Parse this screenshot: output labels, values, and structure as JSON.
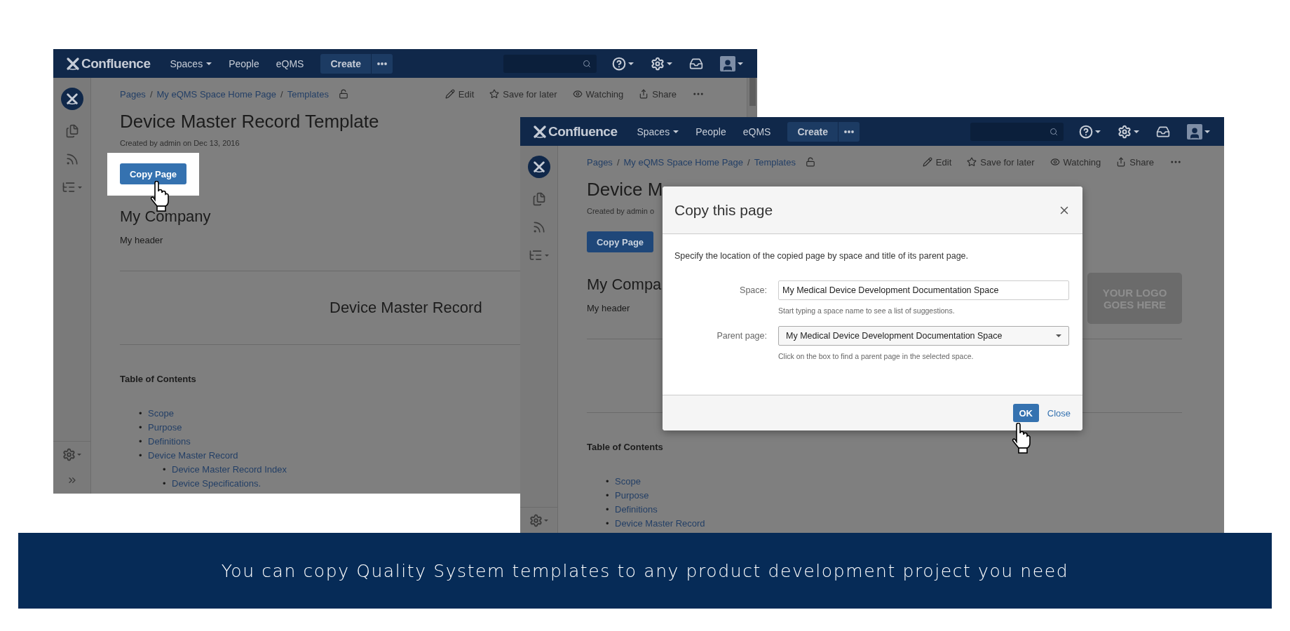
{
  "screenshots": [
    {
      "nav": {
        "logo": "Confluence",
        "menu": [
          {
            "label": "Spaces",
            "dropdown": true
          },
          {
            "label": "People",
            "dropdown": false
          },
          {
            "label": "eQMS",
            "dropdown": false
          }
        ],
        "create": "Create"
      },
      "breadcrumbs": [
        {
          "kind": "link",
          "label": "Pages"
        },
        {
          "kind": "separator",
          "label": "/"
        },
        {
          "kind": "link",
          "label": "My eQMS Space Home Page"
        },
        {
          "kind": "separator",
          "label": "/"
        },
        {
          "kind": "link",
          "label": "Templates"
        }
      ],
      "actions": [
        {
          "kind": "edit",
          "label": "Edit"
        },
        {
          "kind": "save",
          "label": "Save for later"
        },
        {
          "kind": "watch",
          "label": "Watching"
        },
        {
          "kind": "share",
          "label": "Share"
        }
      ],
      "title": "Device Master Record Template",
      "byline": "Created by admin on Dec 13, 2016",
      "copy_button": {
        "label": "Copy Page",
        "highlighted": true
      },
      "heading": "My Company",
      "header_text": "My header",
      "record_heading": "Device Master Record",
      "toc_title": "Table of Contents",
      "toc": [
        {
          "marker": "•",
          "label": "Scope"
        },
        {
          "marker": "•",
          "label": "Purpose"
        },
        {
          "marker": "•",
          "label": "Definitions"
        },
        {
          "marker": "•",
          "label": "Device Master Record",
          "children": [
            {
              "marker": "•",
              "label": "Device Master Record Index"
            },
            {
              "marker": "•",
              "label": "Device Specifications."
            }
          ]
        }
      ],
      "collapse": true,
      "scrollbar": true
    },
    {
      "nav": {
        "logo": "Confluence",
        "menu": [
          {
            "label": "Spaces",
            "dropdown": true
          },
          {
            "label": "People",
            "dropdown": false
          },
          {
            "label": "eQMS",
            "dropdown": false
          }
        ],
        "create": "Create"
      },
      "breadcrumbs": [
        {
          "kind": "link",
          "label": "Pages"
        },
        {
          "kind": "separator",
          "label": "/"
        },
        {
          "kind": "link",
          "label": "My eQMS Space Home Page"
        },
        {
          "kind": "separator",
          "label": "/"
        },
        {
          "kind": "link",
          "label": "Templates"
        }
      ],
      "actions": [
        {
          "kind": "edit",
          "label": "Edit"
        },
        {
          "kind": "save",
          "label": "Save for later"
        },
        {
          "kind": "watch",
          "label": "Watching"
        },
        {
          "kind": "share",
          "label": "Share"
        }
      ],
      "title": "Device M",
      "byline": "Created by admin o",
      "copy_button": {
        "label": "Copy Page",
        "highlighted": false
      },
      "heading": "My Compa",
      "header_text": "My header",
      "logo_placeholder": "YOUR LOGO GOES HERE",
      "toc_title": "Table of Contents",
      "toc": [
        {
          "marker": "•",
          "label": "Scope"
        },
        {
          "marker": "•",
          "label": "Purpose"
        },
        {
          "marker": "•",
          "label": "Definitions"
        },
        {
          "marker": "•",
          "label": "Device Master Record"
        }
      ],
      "collapse": false,
      "scrollbar": false,
      "dialog": {
        "title": "Copy this page",
        "description": "Specify the location of the copied page by space and title of its parent page.",
        "fields": [
          {
            "kind": "text",
            "label": "Space:",
            "value": "My Medical Device Development Documentation Space",
            "hint": "Start typing a space name to see a list of suggestions."
          },
          {
            "kind": "select",
            "label": "Parent page:",
            "value": "My Medical Device Development Documentation Space",
            "hint": "Click on the box to find a parent page in the selected space."
          }
        ],
        "ok": "OK",
        "close": "Close"
      }
    }
  ],
  "banner": "You can copy Quality System templates to any product development project you need"
}
